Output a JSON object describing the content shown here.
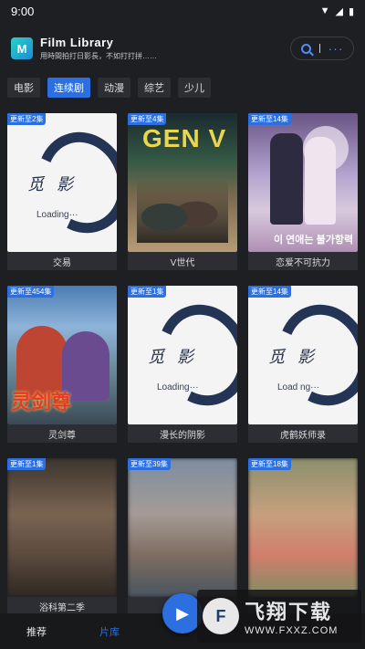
{
  "status_bar": {
    "time": "9:00"
  },
  "header": {
    "logo_letter": "M",
    "title": "Film Library",
    "subtitle": "用時間拍打日影長，不如打打拼……"
  },
  "tabs": [
    "电影",
    "连续剧",
    "动漫",
    "综艺",
    "少儿"
  ],
  "active_tab": "连续剧",
  "cards": [
    {
      "badge": "更新至2集",
      "caption": "交易",
      "poster": "loading",
      "loading_text": "Loading···",
      "brush_text": "觅影"
    },
    {
      "badge": "更新至4集",
      "caption": "V世代",
      "poster": "gen-v",
      "poster_title": "GEN V"
    },
    {
      "badge": "更新至14集",
      "caption": "恋爱不可抗力",
      "poster": "romance",
      "poster_title": "이 연애는 불가항력"
    },
    {
      "badge": "更新至454集",
      "caption": "灵剑尊",
      "poster": "sword",
      "poster_title": "灵剑尊"
    },
    {
      "badge": "更新至1集",
      "caption": "漫长的阴影",
      "poster": "loading",
      "loading_text": "Loading···",
      "brush_text": "觅影"
    },
    {
      "badge": "更新至14集",
      "caption": "虎鹤妖师录",
      "poster": "loading",
      "loading_text": "Load ng···",
      "brush_text": "觅影"
    },
    {
      "badge": "更新至1集",
      "caption": "浴科第二季",
      "poster": "blur1"
    },
    {
      "badge": "更新至39集",
      "caption": "不",
      "poster": "blur2"
    },
    {
      "badge": "更新至18集",
      "caption": "",
      "poster": "blur3"
    }
  ],
  "bottom_nav": {
    "home": "推荐",
    "library": "片库"
  },
  "watermark": {
    "big": "飞翔下载",
    "url": "WWW.FXXZ.COM"
  }
}
